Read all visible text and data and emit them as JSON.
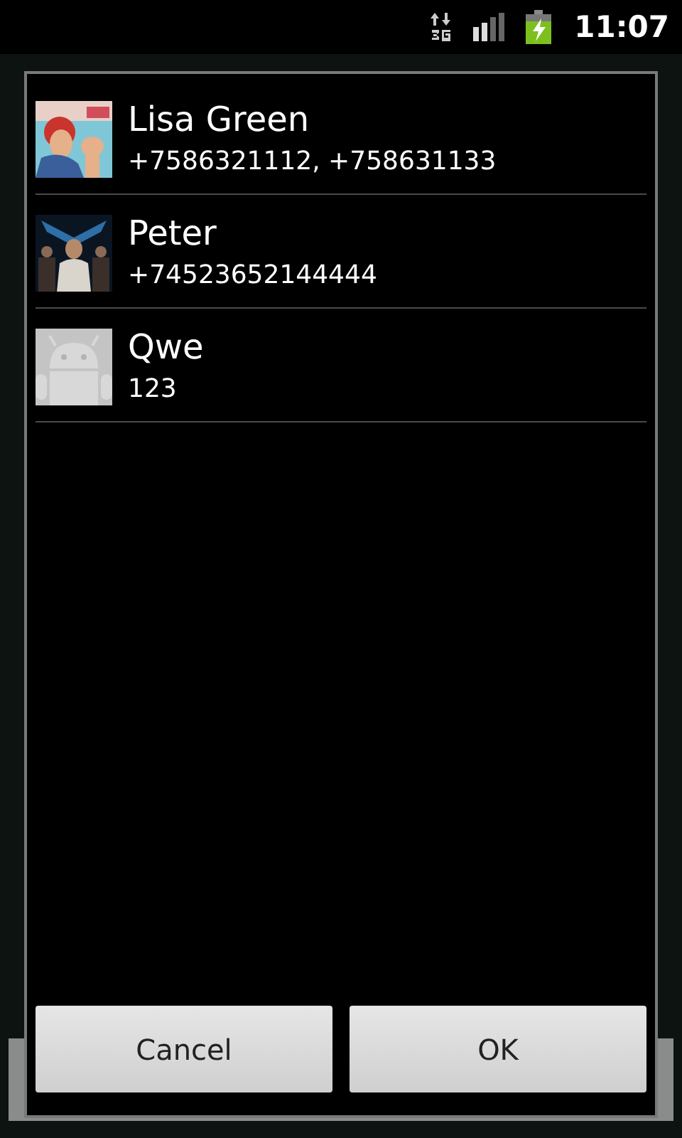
{
  "status_bar": {
    "time": "11:07"
  },
  "contacts": [
    {
      "name": "Lisa Green",
      "phones": "+7586321112, +758631133"
    },
    {
      "name": "Peter",
      "phones": "+74523652144444"
    },
    {
      "name": "Qwe",
      "phones": "123",
      "avatar": {
        "kind": "default"
      }
    }
  ],
  "buttons": [
    "Cancel",
    "OK"
  ]
}
